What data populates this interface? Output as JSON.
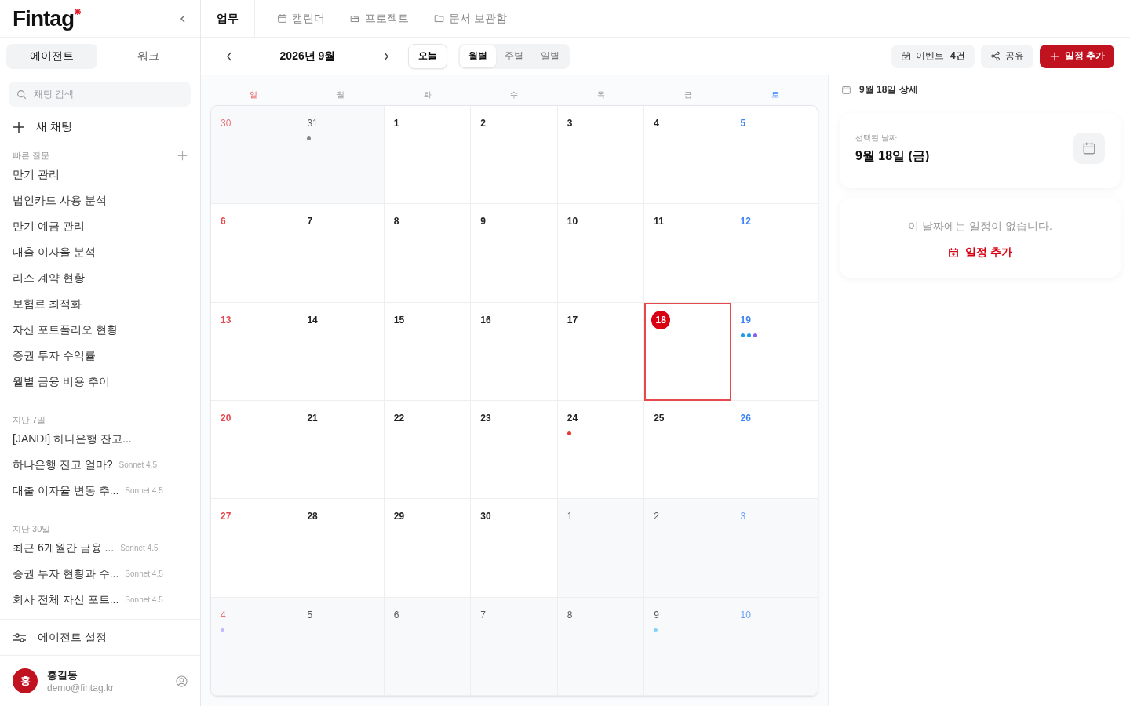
{
  "sidebar": {
    "logo": "Fintag",
    "tabs": [
      {
        "label": "에이전트",
        "selected": true
      },
      {
        "label": "워크",
        "selected": false
      }
    ],
    "search": {
      "placeholder": "채팅 검색"
    },
    "new_chat": "새 채팅",
    "quick_questions": {
      "title": "빠른 질문",
      "items": [
        "만기 관리",
        "법인카드 사용 분석",
        "만기 예금 관리",
        "대출 이자율 분석",
        "리스 계약 현황",
        "보험료 최적화",
        "자산 포트폴리오 현황",
        "증권 투자 수익률",
        "월별 금융 비용 추이"
      ]
    },
    "history": [
      {
        "title": "지난 7일",
        "items": [
          {
            "title": "[JANDI] 하나은행 잔고..."
          },
          {
            "title": "하나은행 잔고 얼마?",
            "model": "Sonnet 4.5"
          },
          {
            "title": "대출 이자율 변동 추...",
            "model": "Sonnet 4.5"
          }
        ]
      },
      {
        "title": "지난 30일",
        "items": [
          {
            "title": "최근 6개월간 금융 ...",
            "model": "Sonnet 4.5"
          },
          {
            "title": "증권 투자 현황과 수...",
            "model": "Sonnet 4.5"
          },
          {
            "title": "회사 전체 자산 포트...",
            "model": "Sonnet 4.5"
          }
        ]
      }
    ],
    "settings": "에이전트 설정",
    "user": {
      "avatar": "홍",
      "name": "홍길동",
      "email": "demo@fintag.kr"
    }
  },
  "tabs": [
    {
      "label": "업무",
      "selected": true
    },
    {
      "label": "캘린더",
      "selected": false
    },
    {
      "label": "프로젝트",
      "selected": false
    },
    {
      "label": "문서 보관함",
      "selected": false
    }
  ],
  "toolbar": {
    "month": "2026년 9월",
    "today": "오늘",
    "views": [
      {
        "label": "월별",
        "selected": true
      },
      {
        "label": "주별",
        "selected": false
      },
      {
        "label": "일별",
        "selected": false
      }
    ],
    "events": {
      "label": "이벤트",
      "count": "4건"
    },
    "share": "공유",
    "add": "일정 추가"
  },
  "calendar": {
    "weekdays": [
      "일",
      "월",
      "화",
      "수",
      "목",
      "금",
      "토"
    ],
    "weeks": [
      [
        {
          "day": "30",
          "in_month": false
        },
        {
          "day": "31",
          "in_month": false,
          "dots": [
            {
              "color": "#888888"
            }
          ]
        },
        {
          "day": "1",
          "in_month": true
        },
        {
          "day": "2",
          "in_month": true
        },
        {
          "day": "3",
          "in_month": true
        },
        {
          "day": "4",
          "in_month": true
        },
        {
          "day": "5",
          "in_month": true
        }
      ],
      [
        {
          "day": "6",
          "in_month": true
        },
        {
          "day": "7",
          "in_month": true
        },
        {
          "day": "8",
          "in_month": true
        },
        {
          "day": "9",
          "in_month": true
        },
        {
          "day": "10",
          "in_month": true
        },
        {
          "day": "11",
          "in_month": true
        },
        {
          "day": "12",
          "in_month": true
        }
      ],
      [
        {
          "day": "13",
          "in_month": true
        },
        {
          "day": "14",
          "in_month": true
        },
        {
          "day": "15",
          "in_month": true
        },
        {
          "day": "16",
          "in_month": true
        },
        {
          "day": "17",
          "in_month": true
        },
        {
          "day": "18",
          "in_month": true,
          "selected": true
        },
        {
          "day": "19",
          "in_month": true,
          "dots": [
            {
              "color": "#1e9be6"
            },
            {
              "color": "#1e9be6"
            },
            {
              "color": "#8b5cf6"
            }
          ]
        }
      ],
      [
        {
          "day": "20",
          "in_month": true
        },
        {
          "day": "21",
          "in_month": true
        },
        {
          "day": "22",
          "in_month": true
        },
        {
          "day": "23",
          "in_month": true
        },
        {
          "day": "24",
          "in_month": true,
          "dots": [
            {
              "color": "#e53935"
            }
          ]
        },
        {
          "day": "25",
          "in_month": true
        },
        {
          "day": "26",
          "in_month": true
        }
      ],
      [
        {
          "day": "27",
          "in_month": true
        },
        {
          "day": "28",
          "in_month": true
        },
        {
          "day": "29",
          "in_month": true
        },
        {
          "day": "30",
          "in_month": true
        },
        {
          "day": "1",
          "in_month": false
        },
        {
          "day": "2",
          "in_month": false
        },
        {
          "day": "3",
          "in_month": false
        }
      ],
      [
        {
          "day": "4",
          "in_month": false,
          "dots": [
            {
              "color": "#c4b5fd"
            }
          ]
        },
        {
          "day": "5",
          "in_month": false
        },
        {
          "day": "6",
          "in_month": false
        },
        {
          "day": "7",
          "in_month": false
        },
        {
          "day": "8",
          "in_month": false
        },
        {
          "day": "9",
          "in_month": false,
          "dots": [
            {
              "color": "#7dd3fc"
            }
          ]
        },
        {
          "day": "10",
          "in_month": false
        }
      ]
    ]
  },
  "detail": {
    "title": "9월 18일 상세",
    "selected_label": "선택된 날짜",
    "selected_date": "9월 18일 (금)",
    "empty": "이 날짜에는 일정이 없습니다.",
    "add": "일정 추가"
  }
}
